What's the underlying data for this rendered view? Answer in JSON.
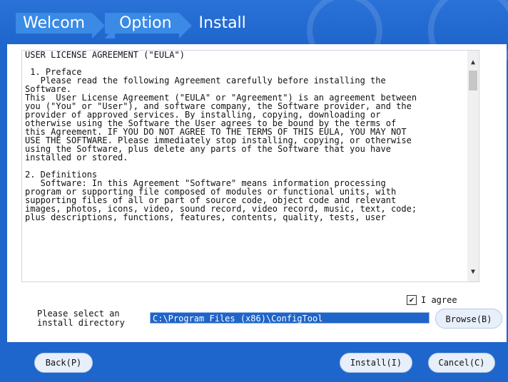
{
  "header": {
    "steps": [
      "Welcom",
      "Option",
      "Install"
    ]
  },
  "eula": {
    "text": "USER LICENSE AGREEMENT (\"EULA\")\n\n 1. Preface\n   Please read the following Agreement carefully before installing the\nSoftware.\nThis  User License Agreement (\"EULA\" or \"Agreement\") is an agreement between\nyou (\"You\" or \"User\"), and software company, the Software provider, and the\nprovider of approved services. By installing, copying, downloading or\notherwise using the Software the User agrees to be bound by the terms of\nthis Agreement. IF YOU DO NOT AGREE TO THE TERMS OF THIS EULA, YOU MAY NOT\nUSE THE SOFTWARE. Please immediately stop installing, copying, or otherwise\nusing the Software, plus delete any parts of the Software that you have\ninstalled or stored.\n\n2. Definitions\n   Software: In this Agreement \"Software\" means information processing\nprogram or supporting file composed of modules or functional units, with\nsupporting files of all or part of source code, object code and relevant\nimages, photos, icons, video, sound record, video record, music, text, code;\nplus descriptions, functions, features, contents, quality, tests, user"
  },
  "agree": {
    "label": "I agree",
    "checkmark": "✔"
  },
  "directory": {
    "label": "Please select an\ninstall directory",
    "value": "C:\\Program Files (x86)\\ConfigTool",
    "browse_label": "Browse(B)"
  },
  "footer": {
    "back_label": "Back(P)",
    "install_label": "Install(I)",
    "cancel_label": "Cancel(C)"
  }
}
